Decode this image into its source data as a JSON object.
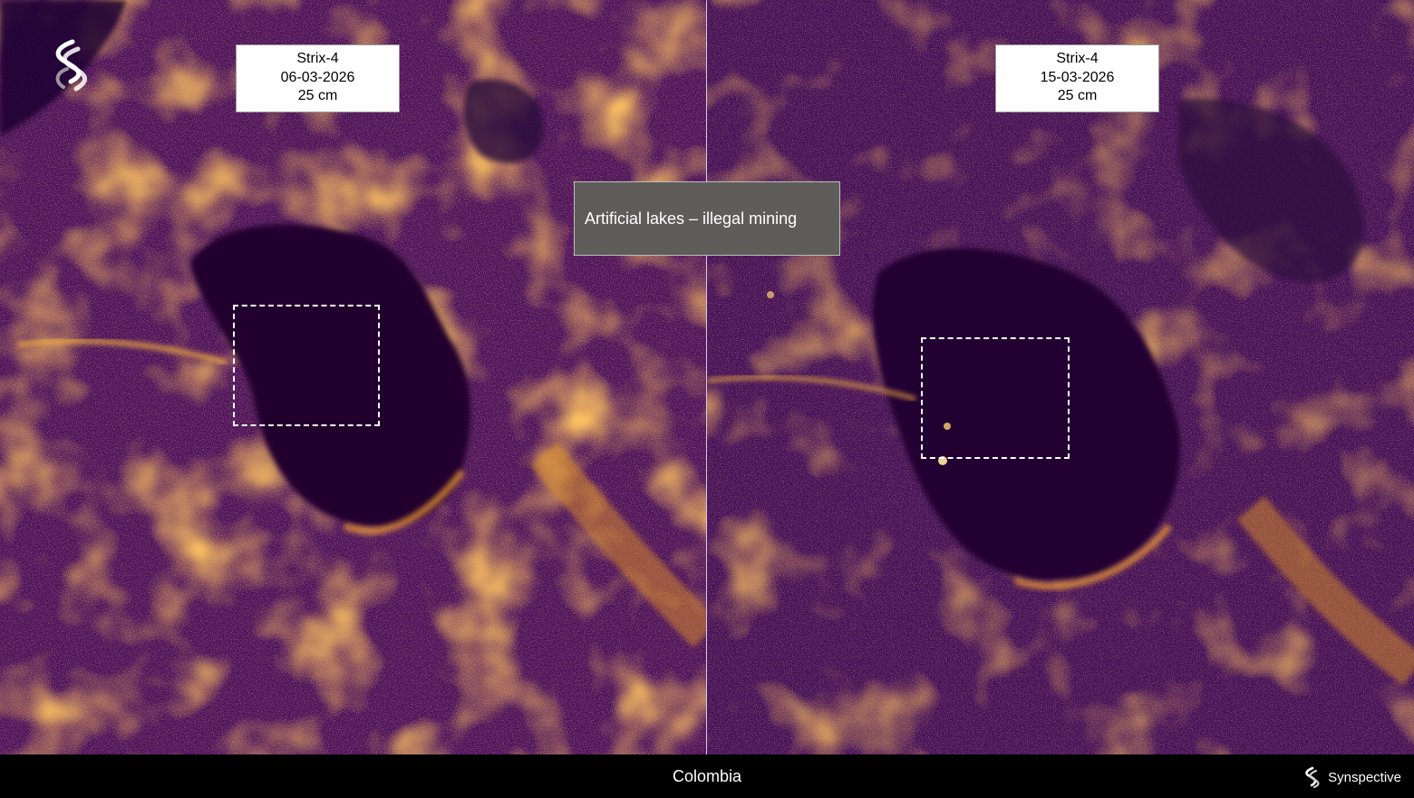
{
  "left_panel": {
    "satellite": "Strix-4",
    "date": "06-03-2026",
    "resolution": "25 cm"
  },
  "right_panel": {
    "satellite": "Strix-4",
    "date": "15-03-2026",
    "resolution": "25 cm"
  },
  "caption": "Artificial lakes – illegal mining",
  "footer": {
    "location": "Colombia",
    "brand_name": "Synspective"
  },
  "colors": {
    "sar_dark": "#2a0846",
    "sar_mid": "#7a1f8a",
    "sar_bright": "#f0a020",
    "caption_bg": "#5e5d5a"
  }
}
